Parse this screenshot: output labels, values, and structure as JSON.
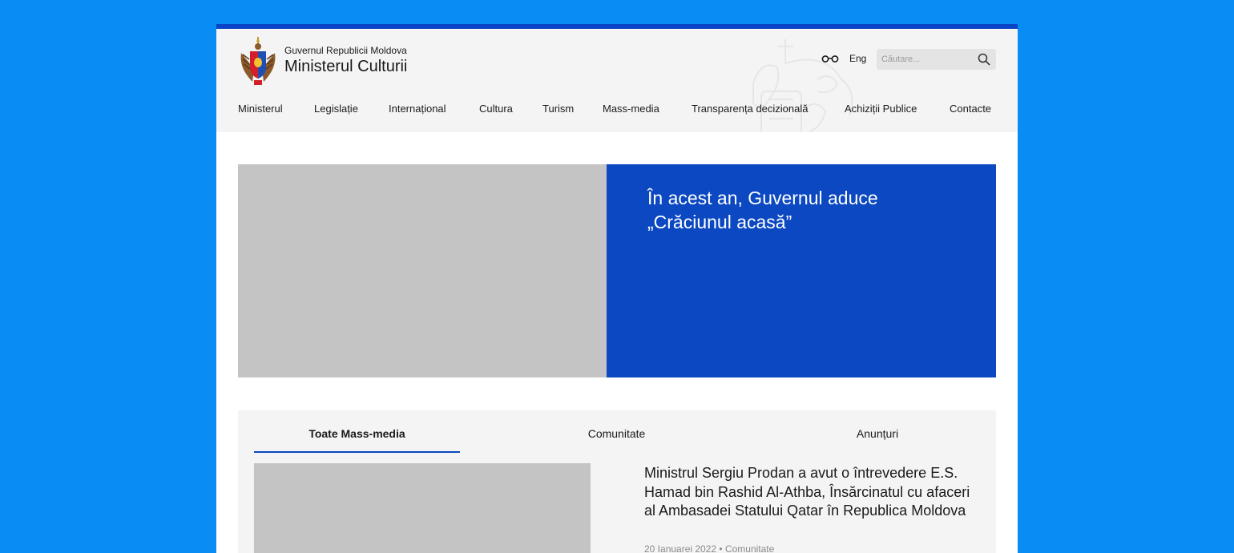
{
  "header": {
    "government_name": "Guvernul Republicii Moldova",
    "ministry_name": "Ministerul Culturii",
    "language_label": "Eng",
    "search_placeholder": "Căutare..."
  },
  "nav": {
    "items": [
      "Ministerul",
      "Legislație",
      "Internațional",
      "Cultura",
      "Turism",
      "Mass-media",
      "Transparența decizională",
      "Achiziții Publice",
      "Contacte"
    ]
  },
  "hero": {
    "title": "În acest an, Guvernul aduce „Crăciunul acasă”"
  },
  "news": {
    "tabs": [
      "Toate Mass-media",
      "Comunitate",
      "Anunțuri"
    ],
    "active_tab": "Toate Mass-media",
    "item": {
      "title": "Ministrul Sergiu Prodan a avut o întrevedere E.S. Hamad bin Rashid Al-Athba, Însărcinatul cu afaceri al Ambasadei Statului Qatar în Republica Moldova",
      "meta": "20 Ianuarei 2022 • Comunitate"
    }
  },
  "colors": {
    "background": "#0a8cf5",
    "accent_blue": "#0b48c1",
    "header_gray": "#f4f4f4",
    "placeholder_gray": "#c4c4c4"
  },
  "icons": [
    "coat-of-arms-logo",
    "glasses-icon",
    "search-icon"
  ]
}
